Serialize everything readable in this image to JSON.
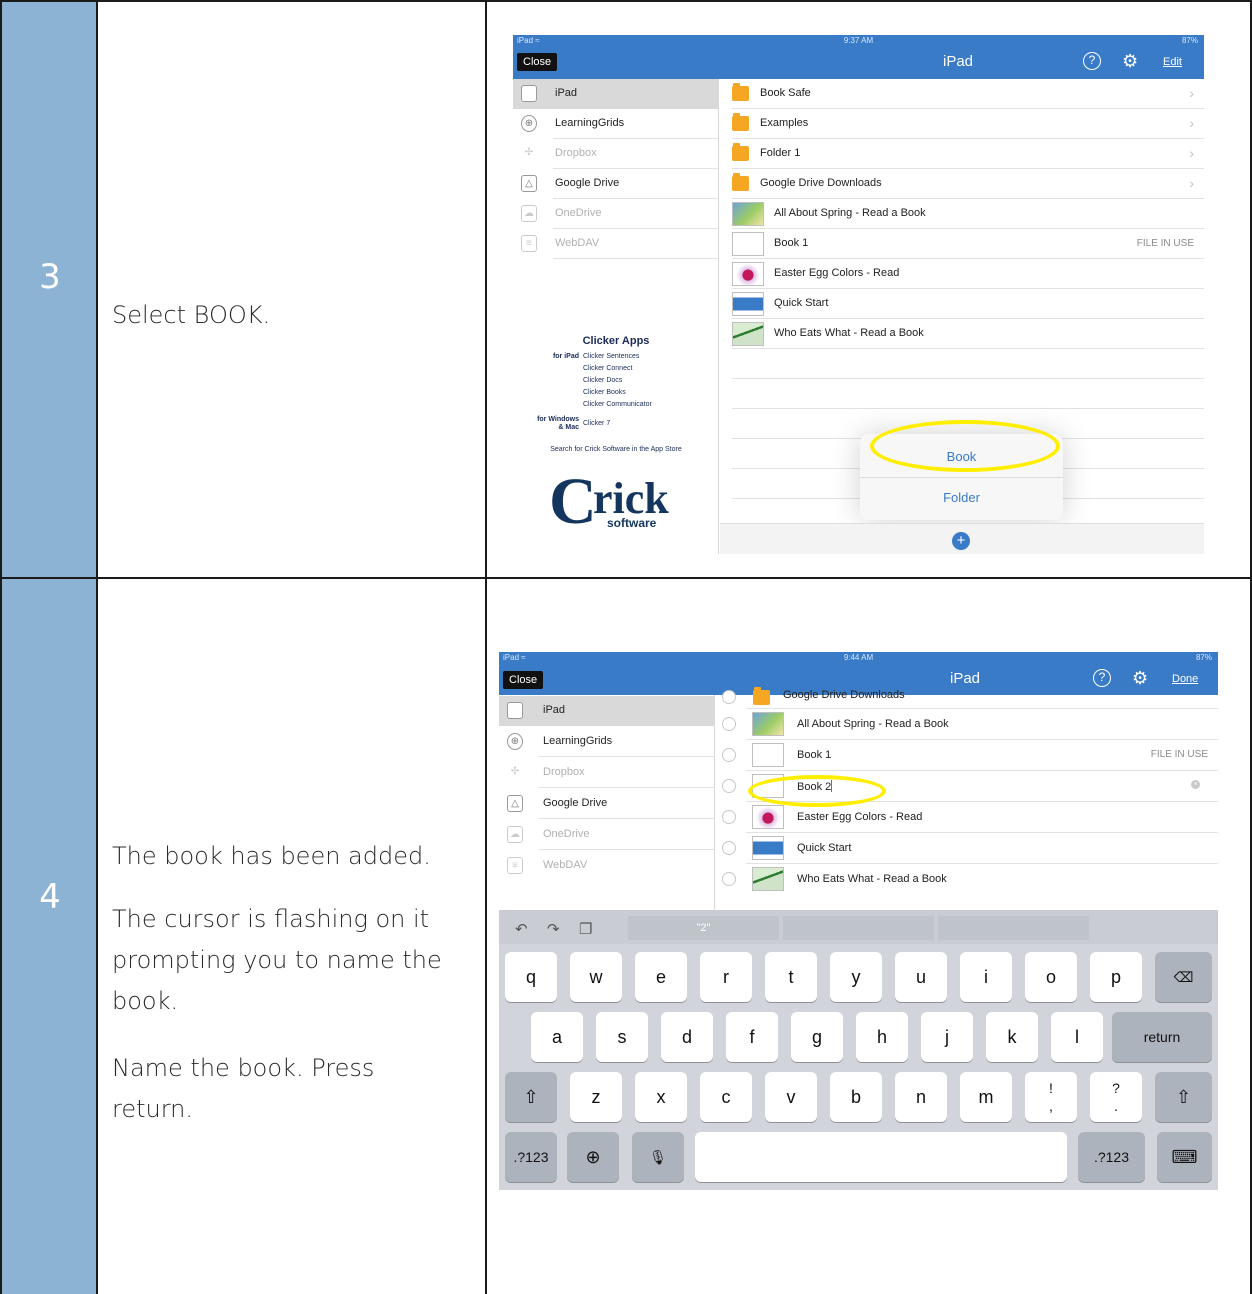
{
  "steps": [
    {
      "number": "3",
      "instructions": [
        "Select BOOK."
      ]
    },
    {
      "number": "4",
      "instructions": [
        "The book has been added.",
        "The cursor is flashing on it prompting you to name the book.",
        "Name the book.  Press return."
      ]
    }
  ],
  "screen_a": {
    "status": {
      "left": "iPad ≈",
      "time": "9:37 AM",
      "battery": "87%"
    },
    "nav": {
      "close": "Close",
      "title": "iPad",
      "action": "Edit"
    },
    "sidebar": [
      "iPad",
      "LearningGrids",
      "Dropbox",
      "Google Drive",
      "OneDrive",
      "WebDAV"
    ],
    "promo": {
      "title": "Clicker Apps",
      "ipad_label": "for iPad",
      "ipad_apps": [
        "Clicker Sentences",
        "Clicker Connect",
        "Clicker Docs",
        "Clicker Books",
        "Clicker Communicator"
      ],
      "desktop_label_1": "for Windows",
      "desktop_label_2": "& Mac",
      "desktop_apps": [
        "Clicker 7"
      ],
      "search": "Search for Crick Software in the App Store",
      "logo_c": "C",
      "logo_rick": "rick",
      "logo_software": "software"
    },
    "files": [
      {
        "name": "Book Safe",
        "kind": "folder",
        "chevron": "›"
      },
      {
        "name": "Examples",
        "kind": "folder",
        "chevron": "›"
      },
      {
        "name": "Folder 1",
        "kind": "folder",
        "chevron": "›"
      },
      {
        "name": "Google Drive Downloads",
        "kind": "folder",
        "chevron": "›"
      },
      {
        "name": "All About Spring - Read a Book",
        "kind": "pic"
      },
      {
        "name": "Book 1",
        "kind": "blank",
        "status": "FILE IN USE"
      },
      {
        "name": "Easter Egg Colors - Read",
        "kind": "egg"
      },
      {
        "name": "Quick Start",
        "kind": "qs"
      },
      {
        "name": "Who Eats What - Read a Book",
        "kind": "bird"
      }
    ],
    "popover": {
      "book": "Book",
      "folder": "Folder"
    },
    "add_button": "+"
  },
  "screen_b": {
    "status": {
      "left": "iPad ≈",
      "time": "9:44 AM",
      "battery": "87%"
    },
    "nav": {
      "close": "Close",
      "title": "iPad",
      "action": "Done"
    },
    "sidebar": [
      "iPad",
      "LearningGrids",
      "Dropbox",
      "Google Drive",
      "OneDrive",
      "WebDAV"
    ],
    "files": [
      {
        "name": "Google Drive Downloads",
        "kind": "folder"
      },
      {
        "name": "All About Spring - Read a Book",
        "kind": "pic"
      },
      {
        "name": "Book 1",
        "kind": "blank",
        "status": "FILE IN USE"
      },
      {
        "name": "Book 2",
        "kind": "blank",
        "editing": true
      },
      {
        "name": "Easter Egg Colors - Read",
        "kind": "egg"
      },
      {
        "name": "Quick Start",
        "kind": "qs"
      },
      {
        "name": "Who Eats What - Read a Book",
        "kind": "bird"
      }
    ],
    "keyboard": {
      "suggestions": [
        "\"2\"",
        "",
        ""
      ],
      "row1": [
        "q",
        "w",
        "e",
        "r",
        "t",
        "y",
        "u",
        "i",
        "o",
        "p",
        "⌫"
      ],
      "row2": [
        "a",
        "s",
        "d",
        "f",
        "g",
        "h",
        "j",
        "k",
        "l",
        "return"
      ],
      "row3": [
        "⇧",
        "z",
        "x",
        "c",
        "v",
        "b",
        "n",
        "m",
        "!\n,",
        "?\n.",
        "⇧"
      ],
      "row4": [
        ".?123",
        "⊕",
        "🎙",
        "",
        ".?123",
        "⌨"
      ]
    }
  },
  "colors": {
    "step_bg": "#8db3d4",
    "nav_blue": "#3a7bc8",
    "highlight": "#ffee00",
    "folder": "#f5a623"
  }
}
